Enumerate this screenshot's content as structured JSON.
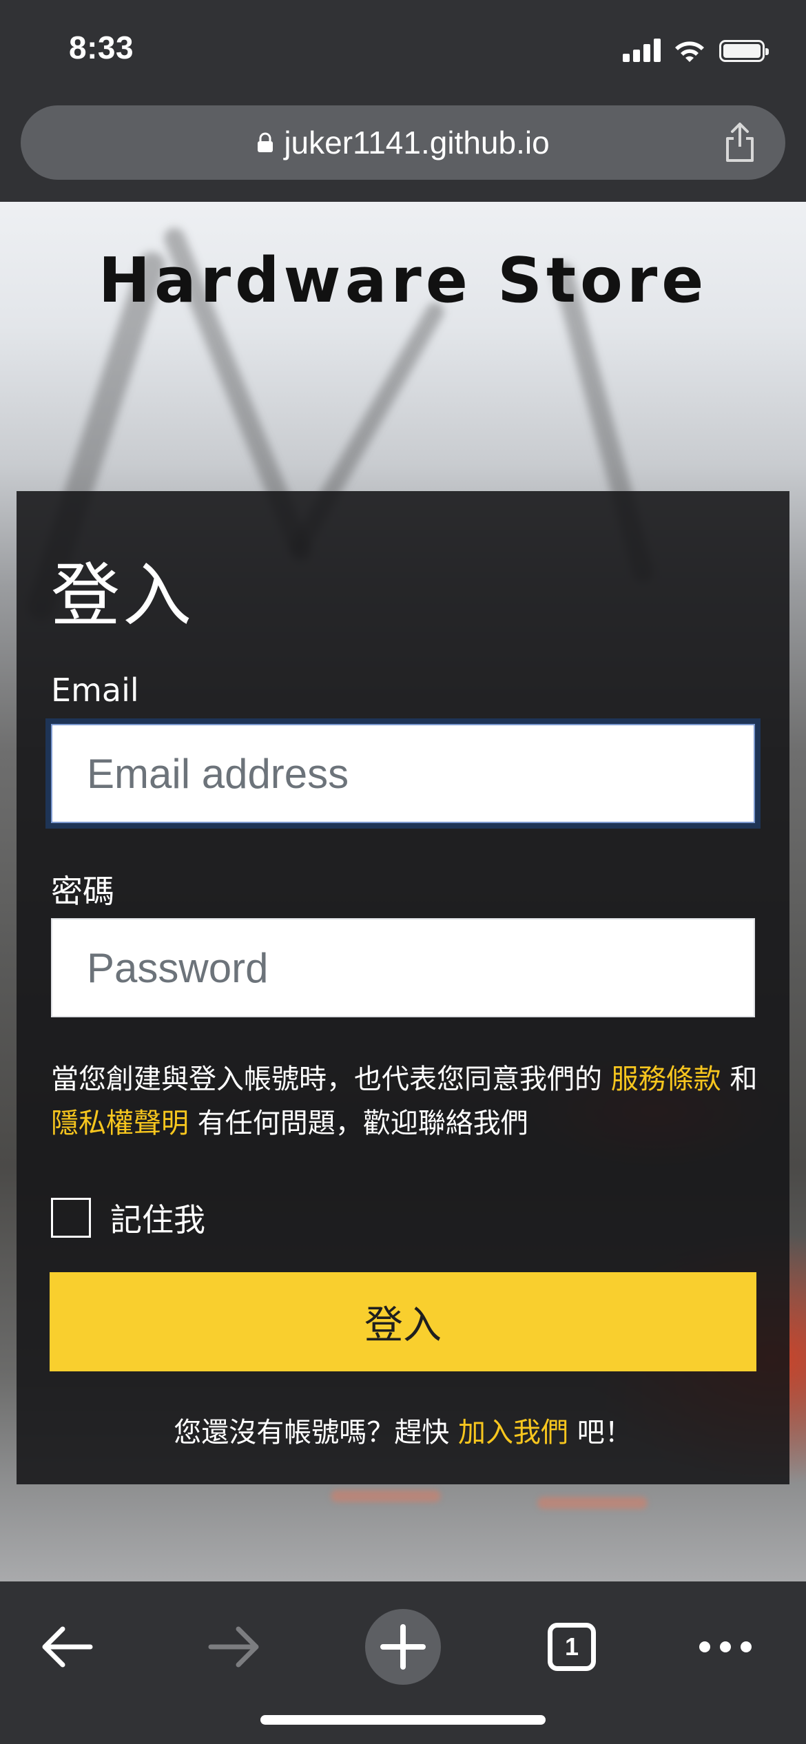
{
  "status_bar": {
    "time": "8:33"
  },
  "browser": {
    "url": "juker1141.github.io",
    "tab_count": "1"
  },
  "page": {
    "site_title": "Hardware Store",
    "login": {
      "title": "登入",
      "email_label": "Email",
      "email_placeholder": "Email address",
      "password_label": "密碼",
      "password_placeholder": "Password",
      "terms_prefix": "當您創建與登入帳號時，也代表您同意我們的",
      "terms_link": "服務條款",
      "terms_and": "和",
      "privacy_link": "隱私權聲明",
      "terms_suffix": "有任何問題，歡迎聯絡我們",
      "remember_label": "記住我",
      "remember_checked": false,
      "submit_label": "登入",
      "signup_prefix": "您還沒有帳號嗎？趕快",
      "signup_link": "加入我們",
      "signup_suffix": "吧！"
    }
  },
  "colors": {
    "accent": "#f9cf2e",
    "link": "#f7c61e",
    "card_bg": "#161618",
    "browser_chrome": "#313235"
  },
  "icons": [
    "signal-icon",
    "wifi-icon",
    "battery-icon",
    "lock-icon",
    "share-icon",
    "back-arrow-icon",
    "forward-arrow-icon",
    "plus-icon",
    "tabs-icon",
    "more-icon"
  ]
}
